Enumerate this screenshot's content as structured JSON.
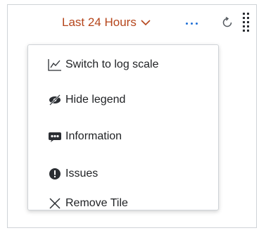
{
  "toolbar": {
    "time_range_label": "Last 24 Hours",
    "more_icon": "ellipsis-icon",
    "refresh_icon": "refresh-icon",
    "drag_icon": "grip-icon",
    "accent_color": "#b5451b",
    "more_color": "#1f6fd6"
  },
  "menu": {
    "items": [
      {
        "label": "Switch to log scale",
        "icon": "line-chart-icon"
      },
      {
        "label": "Hide legend",
        "icon": "eye-slash-icon"
      },
      {
        "label": "Information",
        "icon": "info-bubble-icon"
      },
      {
        "label": "Issues",
        "icon": "alert-circle-icon"
      },
      {
        "label": "Remove Tile",
        "icon": "close-icon"
      }
    ]
  }
}
